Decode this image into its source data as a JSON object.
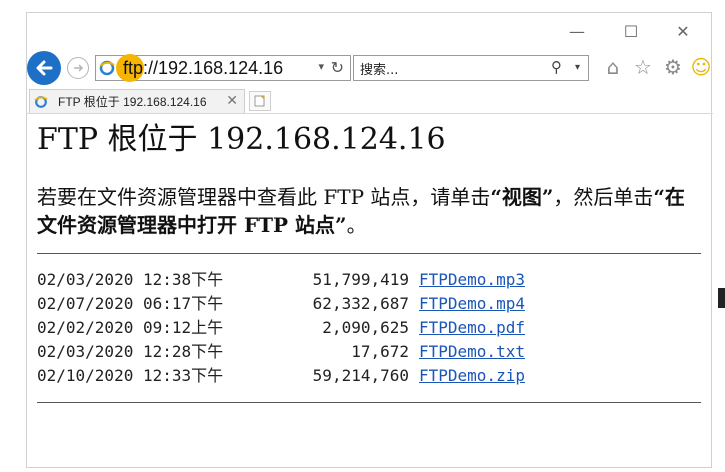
{
  "window": {
    "caption_minimize": "—",
    "caption_maximize": "☐",
    "caption_close": "✕"
  },
  "address": {
    "protocol": "ftp",
    "rest": "://192.168.124.16",
    "search_placeholder": "搜索..."
  },
  "tab": {
    "label": "FTP 根位于 192.168.124.16",
    "close": "✕"
  },
  "page": {
    "title": "FTP 根位于 192.168.124.16",
    "instr_part1": "若要在文件资源管理器中查看此 FTP 站点，请单击",
    "instr_bold1": "“视图”",
    "instr_part2": "，然后单击",
    "instr_bold2": "“在文件资源管理器中打开 FTP 站点”",
    "instr_part3": "。"
  },
  "files": [
    {
      "date": "02/03/2020 12:38下午",
      "size": "51,799,419",
      "name": "FTPDemo.mp3"
    },
    {
      "date": "02/07/2020 06:17下午",
      "size": "62,332,687",
      "name": "FTPDemo.mp4"
    },
    {
      "date": "02/02/2020 09:12上午",
      "size": "2,090,625",
      "name": "FTPDemo.pdf"
    },
    {
      "date": "02/03/2020 12:28下午",
      "size": "17,672",
      "name": "FTPDemo.txt"
    },
    {
      "date": "02/10/2020 12:33下午",
      "size": "59,214,760",
      "name": "FTPDemo.zip"
    }
  ],
  "colors": {
    "accent_blue": "#1e6fc6",
    "highlight": "#f6b500",
    "link": "#1a55b8"
  }
}
